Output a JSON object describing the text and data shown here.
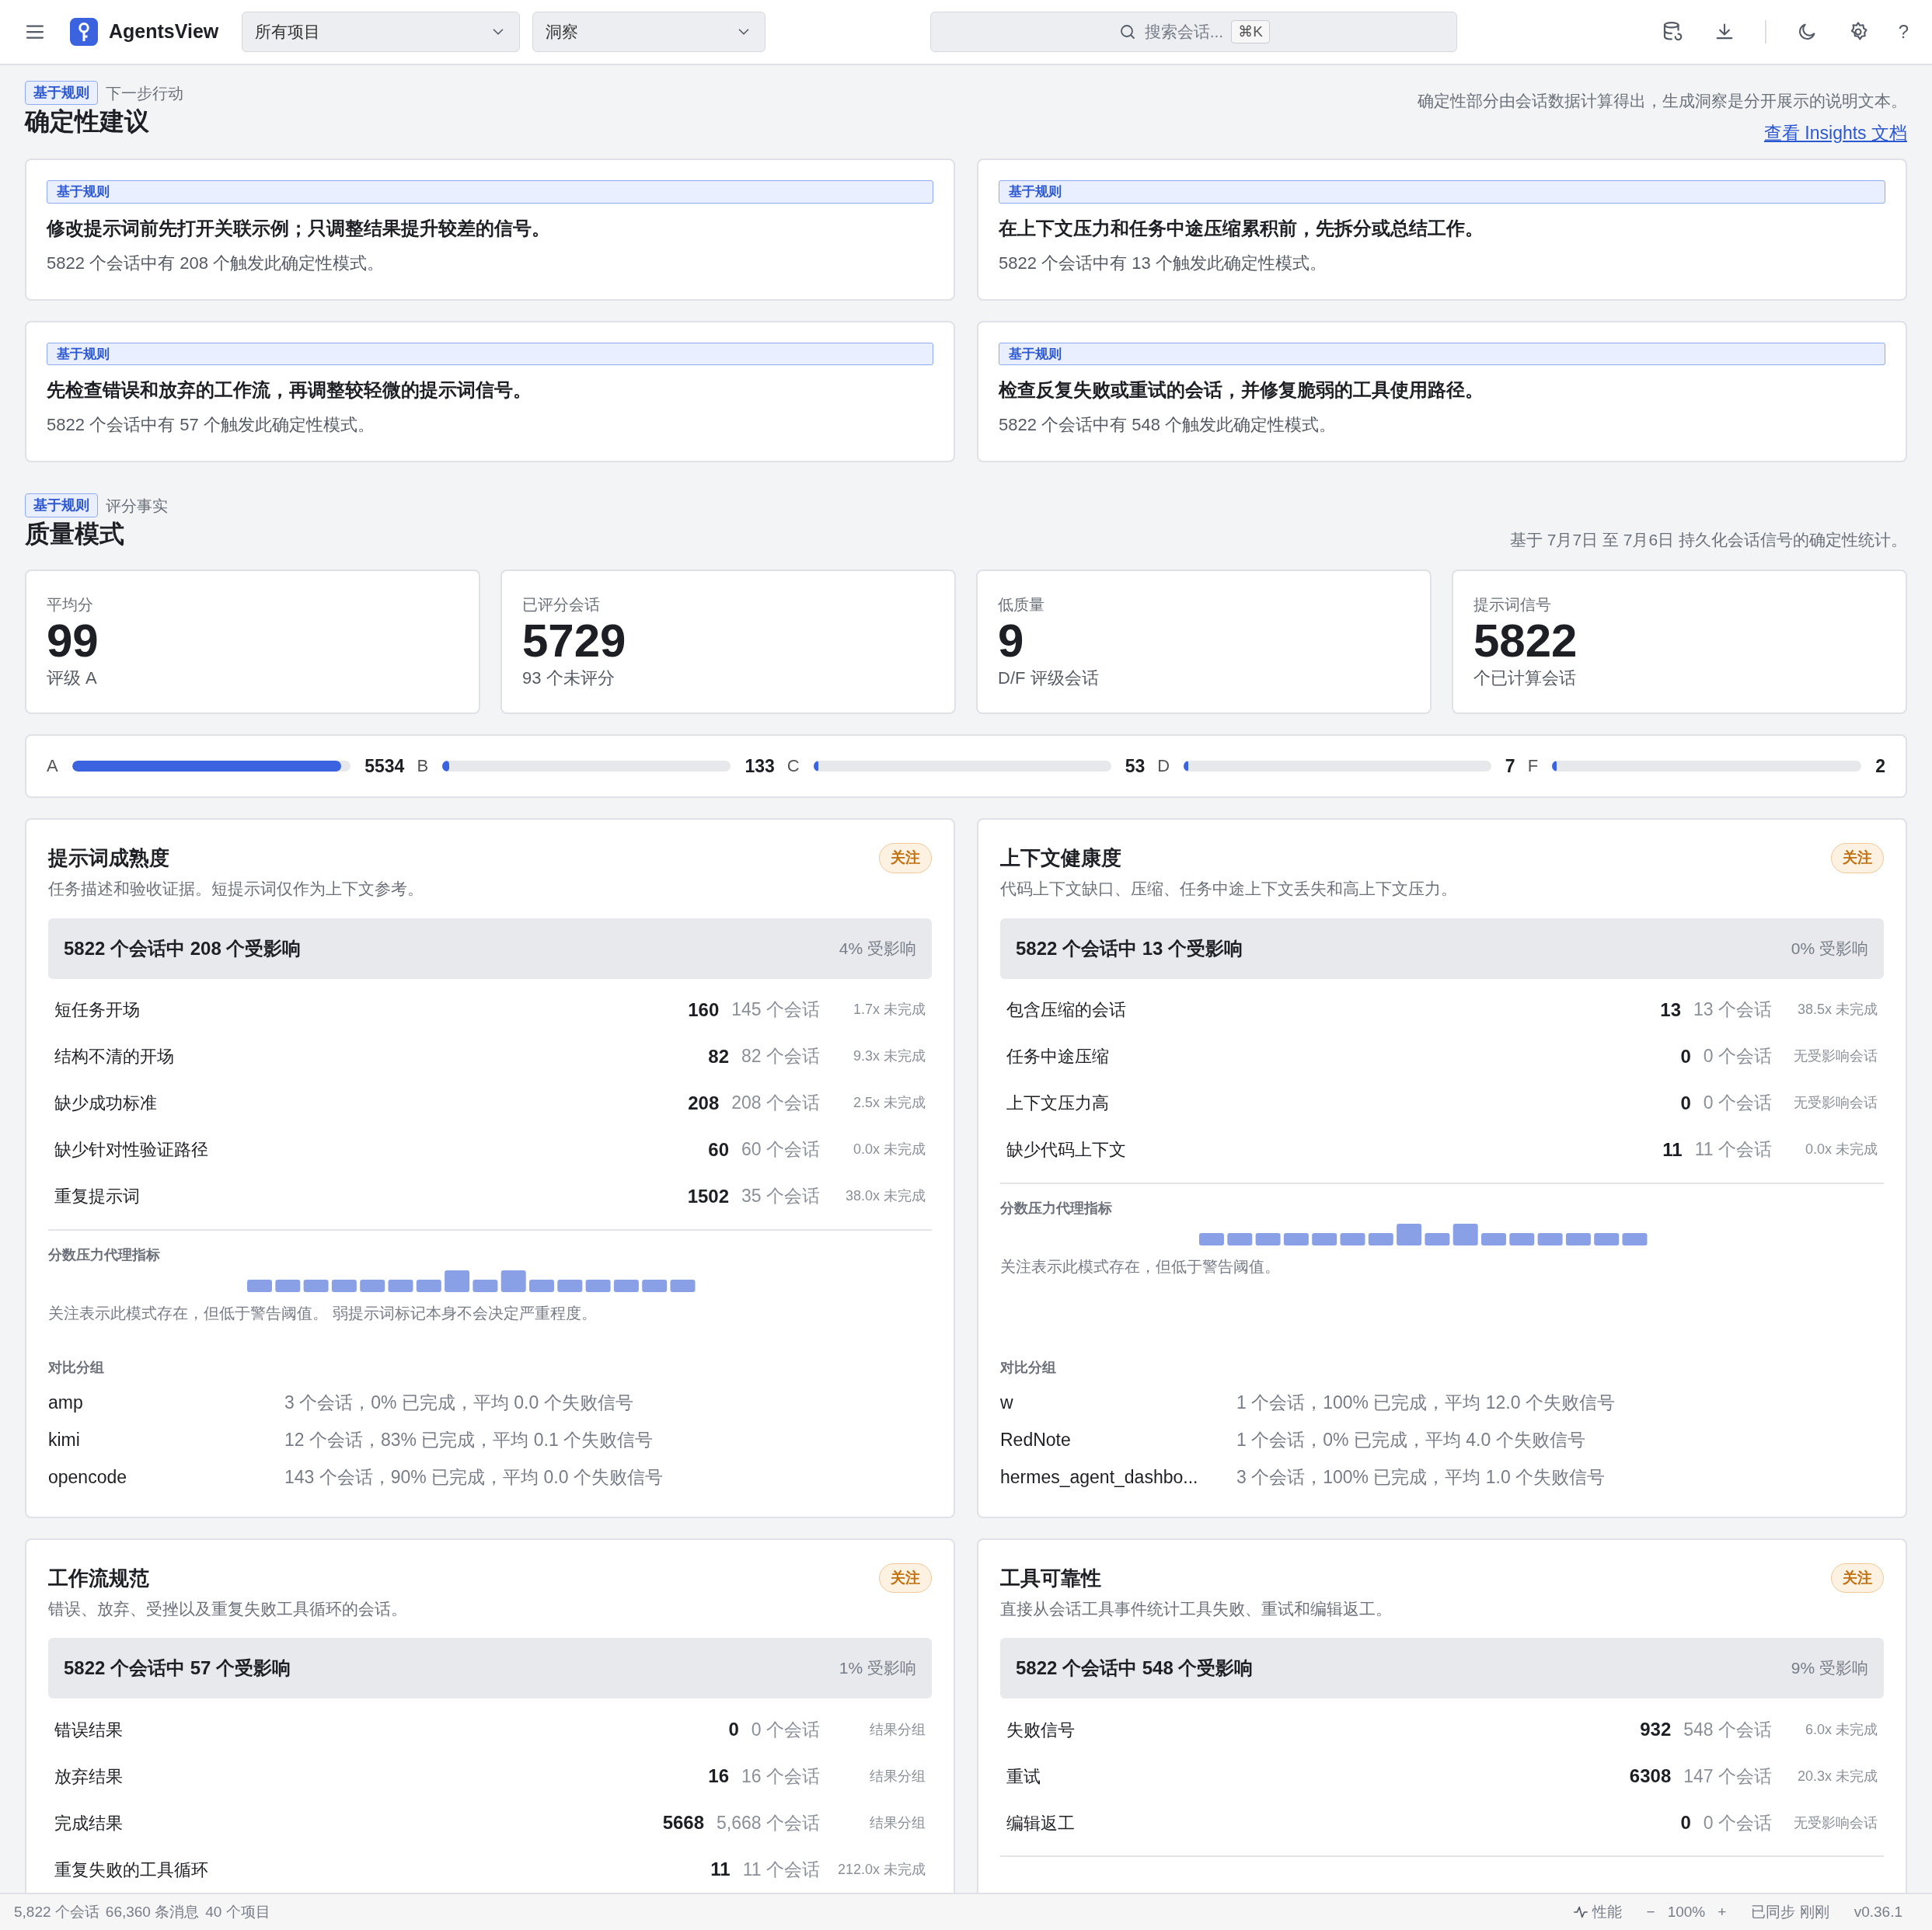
{
  "header": {
    "app_name": "AgentsView",
    "project_select": "所有项目",
    "view_select": "洞察",
    "search": {
      "placeholder": "搜索会话...",
      "shortcut": "⌘K"
    },
    "help": "?"
  },
  "next_actions": {
    "tag": "基于规则",
    "subtitle": "下一步行动",
    "title": "确定性建议",
    "note": "确定性部分由会话数据计算得出，生成洞察是分开展示的说明文本。",
    "docs_link": "查看 Insights 文档",
    "cards": [
      {
        "tag": "基于规则",
        "title": "修改提示词前先打开关联示例；只调整结果提升较差的信号。",
        "detail": "5822 个会话中有 208 个触发此确定性模式。"
      },
      {
        "tag": "基于规则",
        "title": "在上下文压力和任务中途压缩累积前，先拆分或总结工作。",
        "detail": "5822 个会话中有 13 个触发此确定性模式。"
      },
      {
        "tag": "基于规则",
        "title": "先检查错误和放弃的工作流，再调整较轻微的提示词信号。",
        "detail": "5822 个会话中有 57 个触发此确定性模式。"
      },
      {
        "tag": "基于规则",
        "title": "检查反复失败或重试的会话，并修复脆弱的工具使用路径。",
        "detail": "5822 个会话中有 548 个触发此确定性模式。"
      }
    ]
  },
  "quality": {
    "tag": "基于规则",
    "subtitle": "评分事实",
    "title": "质量模式",
    "note": "基于 7月7日 至 7月6日 持久化会话信号的确定性统计。",
    "stats": [
      {
        "label": "平均分",
        "value": "99",
        "sub": "评级 A"
      },
      {
        "label": "已评分会话",
        "value": "5729",
        "sub": "93 个未评分"
      },
      {
        "label": "低质量",
        "value": "9",
        "sub": "D/F 评级会话"
      },
      {
        "label": "提示词信号",
        "value": "5822",
        "sub": "个已计算会话"
      }
    ],
    "grades": [
      {
        "grade": "A",
        "level": 0.966,
        "count": "5534"
      },
      {
        "grade": "B",
        "level": 0.023,
        "count": "133"
      },
      {
        "grade": "C",
        "level": 0.009,
        "count": "53"
      },
      {
        "grade": "D",
        "level": 0.004,
        "count": "7"
      },
      {
        "grade": "F",
        "level": 0.003,
        "count": "2"
      }
    ],
    "patterns": [
      {
        "title": "提示词成熟度",
        "badge": "关注",
        "desc": "任务描述和验收证据。短提示词仅作为上下文参考。",
        "summary": "5822 个会话中 208 个受影响",
        "share": "4% 受影响",
        "rows": [
          {
            "label": "短任务开场",
            "value": "160",
            "sessions": "145 个会话",
            "ratio": "1.7x 未完成"
          },
          {
            "label": "结构不清的开场",
            "value": "82",
            "sessions": "82 个会话",
            "ratio": "9.3x 未完成"
          },
          {
            "label": "缺少成功标准",
            "value": "208",
            "sessions": "208 个会话",
            "ratio": "2.5x 未完成"
          },
          {
            "label": "缺少针对性验证路径",
            "value": "60",
            "sessions": "60 个会话",
            "ratio": "0.0x 未完成"
          },
          {
            "label": "重复提示词",
            "value": "1502",
            "sessions": "35 个会话",
            "ratio": "38.0x 未完成"
          }
        ],
        "proxy_label": "分数压力代理指标",
        "proxy_note": "关注表示此模式存在，但低于警告阈值。 弱提示词标记本身不会决定严重程度。",
        "compare_label": "对比分组",
        "groups": [
          {
            "name": "amp",
            "detail": "3 个会话，0% 已完成，平均 0.0 个失败信号"
          },
          {
            "name": "kimi",
            "detail": "12 个会话，83% 已完成，平均 0.1 个失败信号"
          },
          {
            "name": "opencode",
            "detail": "143 个会话，90% 已完成，平均 0.0 个失败信号"
          }
        ]
      },
      {
        "title": "上下文健康度",
        "badge": "关注",
        "desc": "代码上下文缺口、压缩、任务中途上下文丢失和高上下文压力。",
        "summary": "5822 个会话中 13 个受影响",
        "share": "0% 受影响",
        "rows": [
          {
            "label": "包含压缩的会话",
            "value": "13",
            "sessions": "13 个会话",
            "ratio": "38.5x 未完成"
          },
          {
            "label": "任务中途压缩",
            "value": "0",
            "sessions": "0 个会话",
            "ratio": "无受影响会话"
          },
          {
            "label": "上下文压力高",
            "value": "0",
            "sessions": "0 个会话",
            "ratio": "无受影响会话"
          },
          {
            "label": "缺少代码上下文",
            "value": "11",
            "sessions": "11 个会话",
            "ratio": "0.0x 未完成"
          }
        ],
        "proxy_label": "分数压力代理指标",
        "proxy_note": "关注表示此模式存在，但低于警告阈值。",
        "compare_label": "对比分组",
        "groups": [
          {
            "name": "w",
            "detail": "1 个会话，100% 已完成，平均 12.0 个失败信号"
          },
          {
            "name": "RedNote",
            "detail": "1 个会话，0% 已完成，平均 4.0 个失败信号"
          },
          {
            "name": "hermes_agent_dashbo...",
            "detail": "3 个会话，100% 已完成，平均 1.0 个失败信号"
          }
        ]
      },
      {
        "title": "工作流规范",
        "badge": "关注",
        "desc": "错误、放弃、受挫以及重复失败工具循环的会话。",
        "summary": "5822 个会话中 57 个受影响",
        "share": "1% 受影响",
        "rows": [
          {
            "label": "错误结果",
            "value": "0",
            "sessions": "0 个会话",
            "ratio": "结果分组"
          },
          {
            "label": "放弃结果",
            "value": "16",
            "sessions": "16 个会话",
            "ratio": "结果分组"
          },
          {
            "label": "完成结果",
            "value": "5668",
            "sessions": "5,668 个会话",
            "ratio": "结果分组"
          },
          {
            "label": "重复失败的工具循环",
            "value": "11",
            "sessions": "11 个会话",
            "ratio": "212.0x 未完成"
          }
        ]
      },
      {
        "title": "工具可靠性",
        "badge": "关注",
        "desc": "直接从会话工具事件统计工具失败、重试和编辑返工。",
        "summary": "5822 个会话中 548 个受影响",
        "share": "9% 受影响",
        "rows": [
          {
            "label": "失败信号",
            "value": "932",
            "sessions": "548 个会话",
            "ratio": "6.0x 未完成"
          },
          {
            "label": "重试",
            "value": "6308",
            "sessions": "147 个会话",
            "ratio": "20.3x 未完成"
          },
          {
            "label": "编辑返工",
            "value": "0",
            "sessions": "0 个会话",
            "ratio": "无受影响会话"
          }
        ]
      }
    ]
  },
  "status_bar": {
    "sessions": "5,822 个会话",
    "messages": "66,360 条消息",
    "projects": "40 个项目",
    "perf": "性能",
    "zoom_out": "−",
    "zoom": "100%",
    "zoom_in": "+",
    "sync": "已同步 刚刚",
    "version": "v0.36.1"
  }
}
